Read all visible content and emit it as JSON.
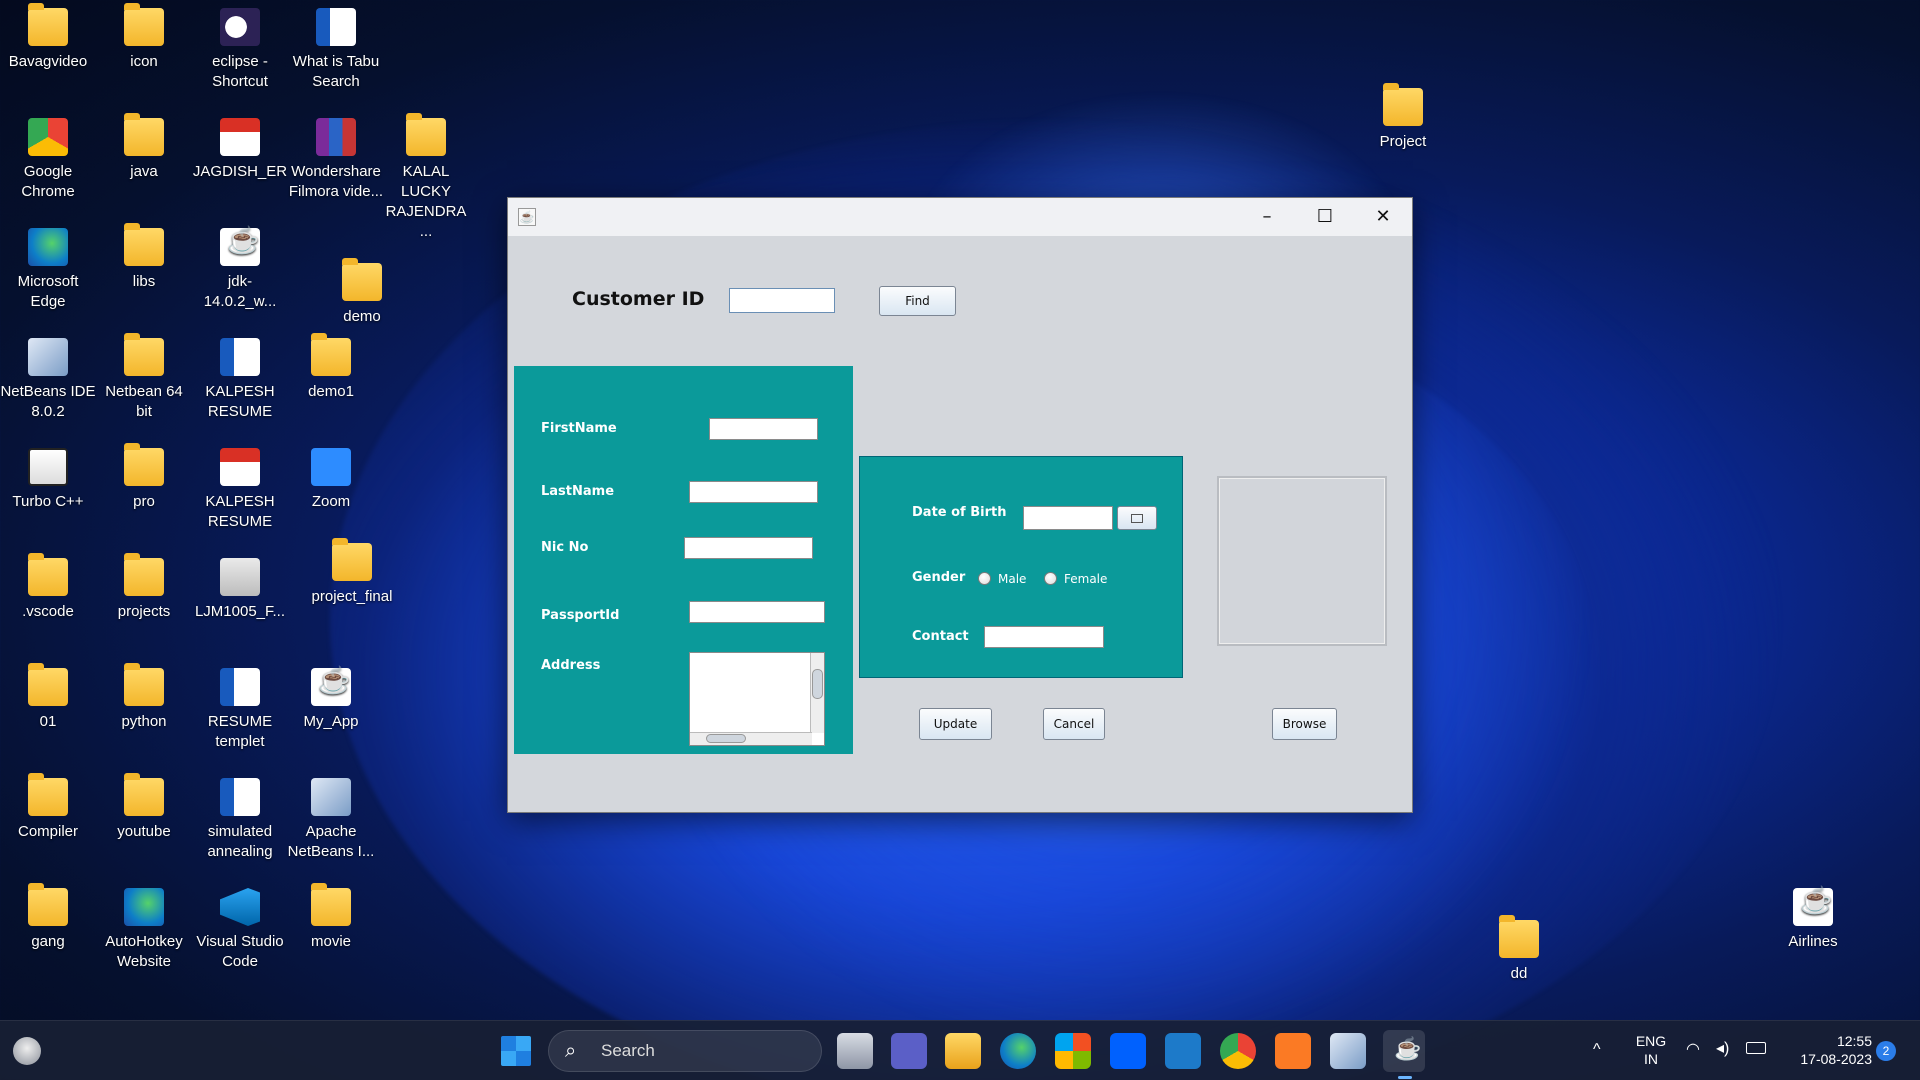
{
  "desktop": {
    "icons": [
      {
        "label": "Bavagvideo",
        "glyph": "folder-icon"
      },
      {
        "label": "icon",
        "glyph": "folder-icon"
      },
      {
        "label": "eclipse - Shortcut",
        "glyph": "eclipse-icon"
      },
      {
        "label": "What is Tabu Search",
        "glyph": "word-icon"
      },
      {
        "label": "Google Chrome",
        "glyph": "chrome-icon"
      },
      {
        "label": "java",
        "glyph": "folder-icon"
      },
      {
        "label": "JAGDISH_ER",
        "glyph": "pdf-icon"
      },
      {
        "label": "Wondershare Filmora vide...",
        "glyph": "winrar-icon"
      },
      {
        "label": "KALAL LUCKY RAJENDRA ...",
        "glyph": "folder-icon"
      },
      {
        "label": "Microsoft Edge",
        "glyph": "edge-icon"
      },
      {
        "label": "libs",
        "glyph": "folder-icon"
      },
      {
        "label": "jdk-14.0.2_w...",
        "glyph": "java-installer-icon"
      },
      {
        "label": "demo",
        "glyph": "folder-icon"
      },
      {
        "label": "NetBeans IDE 8.0.2",
        "glyph": "netbeans-icon"
      },
      {
        "label": "Netbean 64 bit",
        "glyph": "folder-icon"
      },
      {
        "label": "KALPESH RESUME",
        "glyph": "word-icon"
      },
      {
        "label": "demo1",
        "glyph": "folder-icon"
      },
      {
        "label": "Turbo C++",
        "glyph": "turbo-icon"
      },
      {
        "label": "pro",
        "glyph": "folder-icon"
      },
      {
        "label": "KALPESH RESUME",
        "glyph": "pdf-icon"
      },
      {
        "label": "Zoom",
        "glyph": "zoom-icon"
      },
      {
        "label": ".vscode",
        "glyph": "folder-icon"
      },
      {
        "label": "projects",
        "glyph": "folder-icon"
      },
      {
        "label": "LJM1005_F...",
        "glyph": "web-icon"
      },
      {
        "label": "project_final",
        "glyph": "folder-icon"
      },
      {
        "label": "01",
        "glyph": "folder-icon"
      },
      {
        "label": "python",
        "glyph": "folder-icon"
      },
      {
        "label": "RESUME templet",
        "glyph": "word-icon"
      },
      {
        "label": "My_App",
        "glyph": "java-icon"
      },
      {
        "label": "Compiler",
        "glyph": "folder-icon"
      },
      {
        "label": "youtube",
        "glyph": "folder-icon"
      },
      {
        "label": "simulated annealing",
        "glyph": "word-icon"
      },
      {
        "label": "Apache NetBeans I...",
        "glyph": "netbeans-icon"
      },
      {
        "label": "gang",
        "glyph": "folder-icon"
      },
      {
        "label": "AutoHotkey Website",
        "glyph": "edge-icon"
      },
      {
        "label": "Visual Studio Code",
        "glyph": "vscode-icon"
      },
      {
        "label": "movie",
        "glyph": "folder-icon"
      },
      {
        "label": "Project",
        "glyph": "folder-icon"
      },
      {
        "label": "dd",
        "glyph": "folder-icon"
      },
      {
        "label": "Airlines",
        "glyph": "java-icon"
      }
    ]
  },
  "window": {
    "title": "",
    "customer_id_label": "Customer ID",
    "customer_id_value": "",
    "find_button": "Find",
    "firstname_label": "FirstName",
    "lastname_label": "LastName",
    "nic_label": "Nic No",
    "passport_label": "PassportId",
    "address_label": "Address",
    "dob_label": "Date of Birth",
    "gender_label": "Gender",
    "gender_male": "Male",
    "gender_female": "Female",
    "contact_label": "Contact",
    "update_button": "Update",
    "cancel_button": "Cancel",
    "browse_button": "Browse",
    "panel_color": "#0b9a9a"
  },
  "taskbar": {
    "search_placeholder": "Search",
    "lang_top": "ENG",
    "lang_bottom": "IN",
    "time": "12:55",
    "date": "17-08-2023",
    "notification_count": "2"
  }
}
